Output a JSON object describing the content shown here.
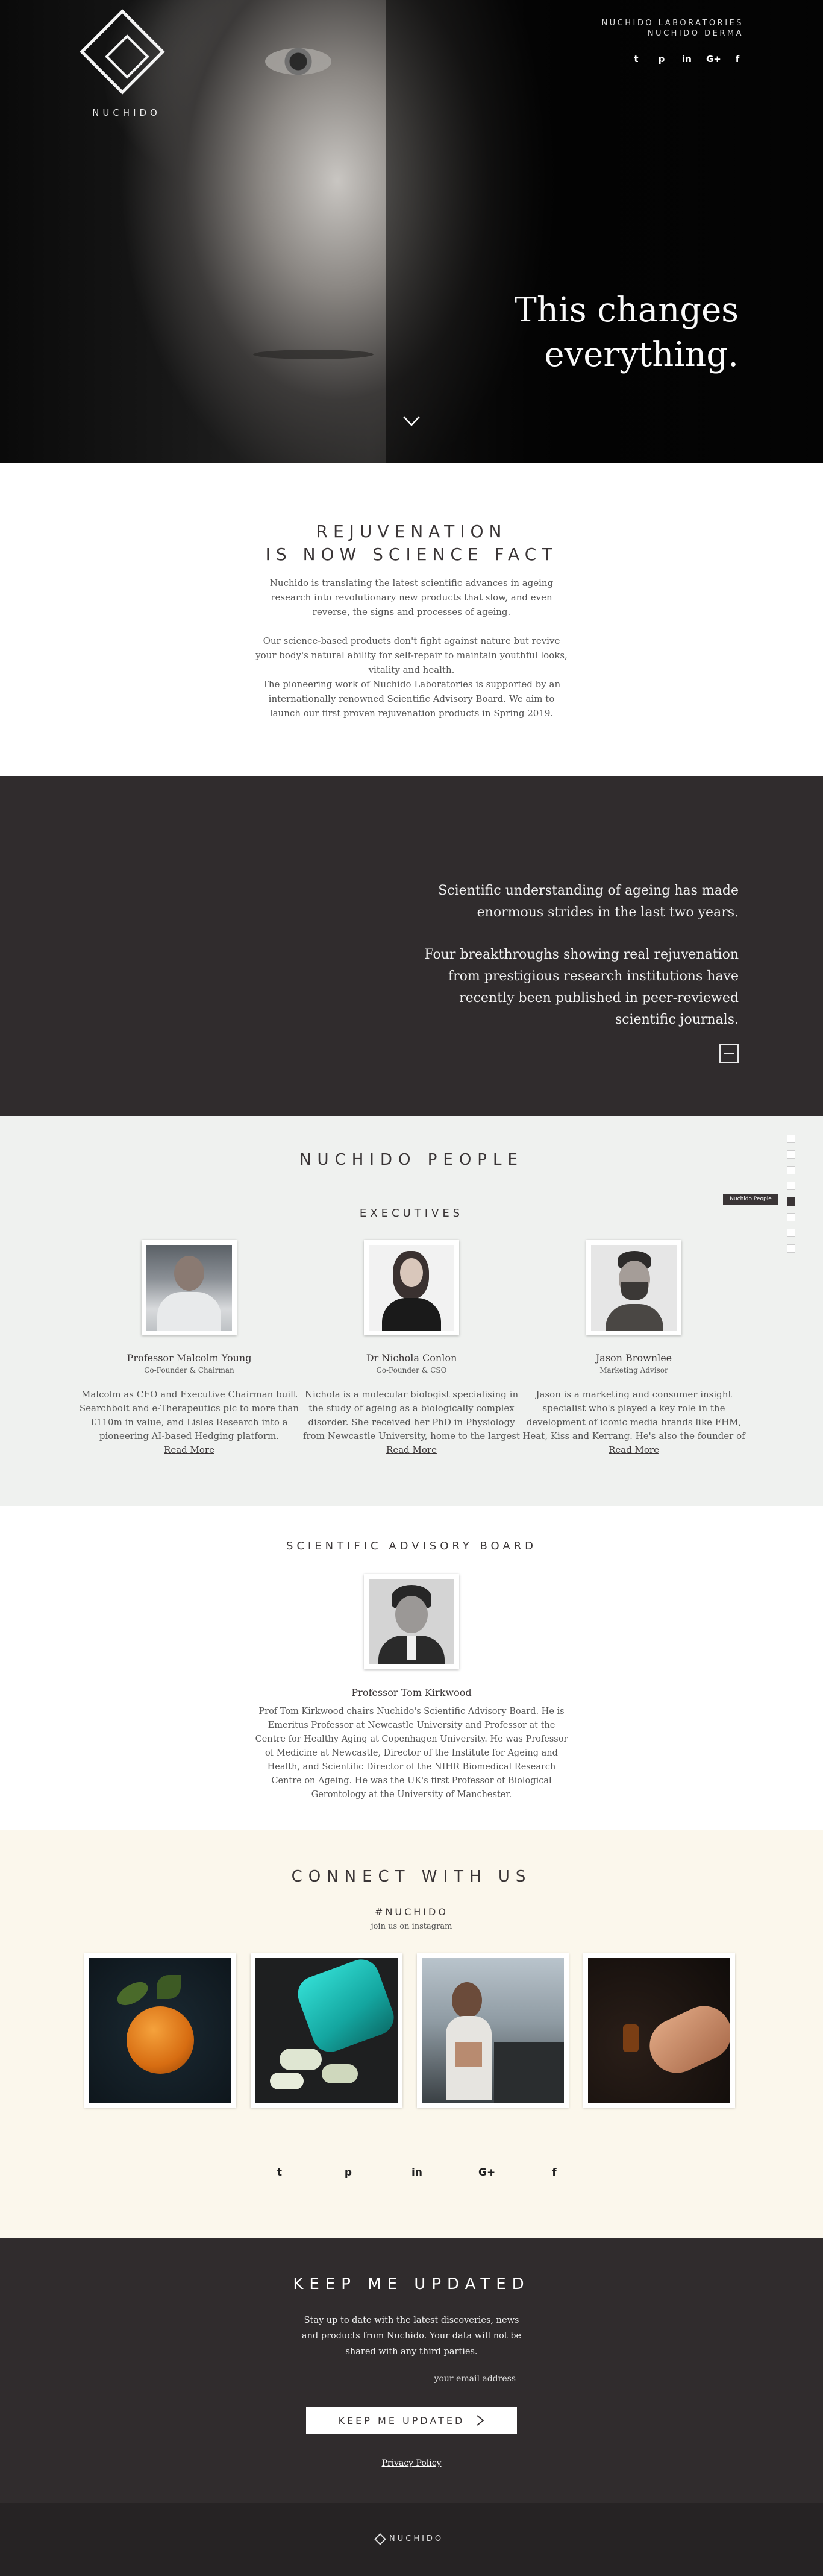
{
  "brand": {
    "name": "NUCHIDO",
    "line1": "NUCHIDO LABORATORIES",
    "line2": "NUCHIDO DERMA"
  },
  "hero": {
    "tagline_line1": "This changes",
    "tagline_line2": "everything."
  },
  "social_icons": [
    "twitter-icon",
    "pinterest-icon",
    "linkedin-icon",
    "google-plus-icon",
    "facebook-icon"
  ],
  "social_glyphs": {
    "twitter": "t",
    "pinterest": "p",
    "linkedin": "in",
    "google": "G+",
    "facebook": "f"
  },
  "rejuvenation": {
    "title_line1": "REJUVENATION",
    "title_line2": "IS NOW SCIENCE FACT",
    "para1": "Nuchido is translating the latest scientific advances in ageing research into revolutionary new products that slow, and even reverse, the signs and processes of ageing.",
    "para2": "Our science-based products don't fight against nature but revive your body's natural ability for self-repair to maintain youthful looks, vitality and health.",
    "para3": "The pioneering work of Nuchido Laboratories is supported by an internationally renowned Scientific Advisory Board. We aim to launch our first proven rejuvenation products in Spring 2019."
  },
  "band": {
    "para1": "Scientific understanding of ageing has made enormous strides in the last two years.",
    "para2": "Four breakthroughs showing real rejuvenation from prestigious research institutions have recently been published in peer-reviewed scientific journals."
  },
  "people": {
    "title": "NUCHIDO PEOPLE",
    "executives_title": "EXECUTIVES",
    "nav_tooltip": "Nuchido People",
    "read_more": "Read More",
    "executives": [
      {
        "name": "Professor Malcolm Young",
        "role": "Co-Founder & Chairman",
        "bio": "Malcolm as CEO and Executive Chairman built Searchbolt and e-Therapeutics plc to more than £110m in value, and Lisles Research into a pioneering AI-based Hedging platform."
      },
      {
        "name": "Dr Nichola Conlon",
        "role": "Co-Founder & CSO",
        "bio": "Nichola is a molecular biologist specialising in the study of ageing as a biologically complex disorder. She received her PhD in Physiology from Newcastle University, home to the largest institute for ageing"
      },
      {
        "name": "Jason Brownlee",
        "role": "Marketing Advisor",
        "bio": "Jason is a marketing and consumer insight specialist who's played a key role in the development of iconic media brands like FHM, Heat, Kiss and Kerrang.  He's also the founder of two successful market research &"
      }
    ]
  },
  "advisory": {
    "title": "SCIENTIFIC ADVISORY BOARD",
    "name": "Professor Tom Kirkwood",
    "bio": "Prof Tom Kirkwood chairs Nuchido's Scientific Advisory Board. He is Emeritus Professor at Newcastle University and Professor at the Centre for Healthy Aging at Copenhagen University. He was Professor of Medicine at Newcastle, Director of the Institute for Ageing and Health, and Scientific Director of the NIHR Biomedical Research Centre on Ageing. He was the UK's first Professor of Biological Gerontology at the University of Manchester."
  },
  "connect": {
    "title": "CONNECT WITH US",
    "hashtag": "#NUCHIDO",
    "subtitle": "join us on instagram"
  },
  "updated": {
    "title": "KEEP ME UPDATED",
    "text": "Stay up to date with the latest discoveries, news and products from Nuchido. Your data will not be shared with any third parties.",
    "email_placeholder": "your email address",
    "button_label": "KEEP ME UPDATED",
    "policy": "Privacy Policy"
  },
  "footer": {
    "logo_text": "NUCHIDO"
  },
  "colors": {
    "dark": "#302c2d",
    "light_gray": "#eff1ef",
    "cream": "#fbf7ec",
    "footer": "#262324"
  }
}
